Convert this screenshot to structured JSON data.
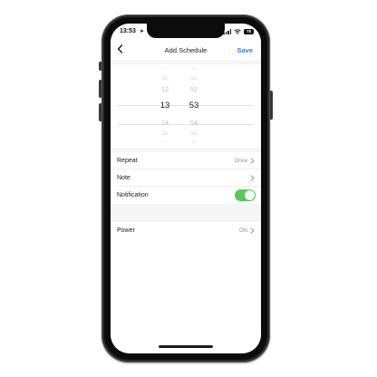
{
  "status_bar": {
    "time": "13:53",
    "location_arrow": "➤",
    "battery": "78"
  },
  "nav": {
    "back_icon": "chevron-left-icon",
    "title": "Add Schedule",
    "save_label": "Save"
  },
  "time_picker": {
    "hours": [
      "10",
      "11",
      "12",
      "13",
      "14",
      "15",
      "16"
    ],
    "minutes": [
      "50",
      "51",
      "52",
      "53",
      "54",
      "55",
      "56"
    ],
    "selected_hour": "13",
    "selected_minute": "53"
  },
  "settings": {
    "repeat": {
      "label": "Repeat",
      "value": "Once"
    },
    "note": {
      "label": "Note",
      "value": ""
    },
    "notification": {
      "label": "Notification",
      "enabled": true
    },
    "power": {
      "label": "Power",
      "value": "ON"
    }
  },
  "colors": {
    "accent": "#3a7bd5",
    "toggle_on": "#5ac85a",
    "background": "#f5f5f7"
  }
}
